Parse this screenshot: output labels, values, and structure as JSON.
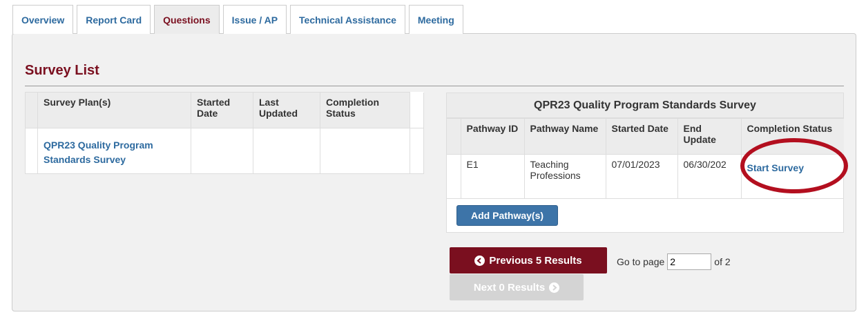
{
  "tabs": [
    {
      "label": "Overview",
      "active": false
    },
    {
      "label": "Report Card",
      "active": false
    },
    {
      "label": "Questions",
      "active": true
    },
    {
      "label": "Issue / AP",
      "active": false
    },
    {
      "label": "Technical Assistance",
      "active": false
    },
    {
      "label": "Meeting",
      "active": false
    }
  ],
  "survey_list": {
    "title": "Survey List",
    "columns": [
      "Survey Plan(s)",
      "Started Date",
      "Last Updated",
      "Completion Status"
    ],
    "rows": [
      {
        "survey_plan": "QPR23 Quality Program Standards Survey",
        "started_date": "",
        "last_updated": "",
        "completion_status": ""
      }
    ]
  },
  "pathway_panel": {
    "title": "QPR23 Quality Program Standards Survey",
    "columns": [
      "Pathway ID",
      "Pathway Name",
      "Started Date",
      "End Update",
      "Completion Status"
    ],
    "rows": [
      {
        "pathway_id": "E1",
        "pathway_name": "Teaching Professions",
        "started_date": "07/01/2023",
        "end_update": "06/30/202",
        "action": "Start Survey"
      }
    ],
    "add_button": "Add Pathway(s)"
  },
  "pagination": {
    "prev_label": "Previous 5 Results",
    "next_label": "Next 0 Results",
    "goto_label": "Go to page",
    "page_value": "2",
    "of_label": "of 2"
  },
  "colors": {
    "brand": "#7a0f1f",
    "link": "#2d6a9f",
    "button": "#3d74a8",
    "highlight_ring": "#b30f1f"
  }
}
